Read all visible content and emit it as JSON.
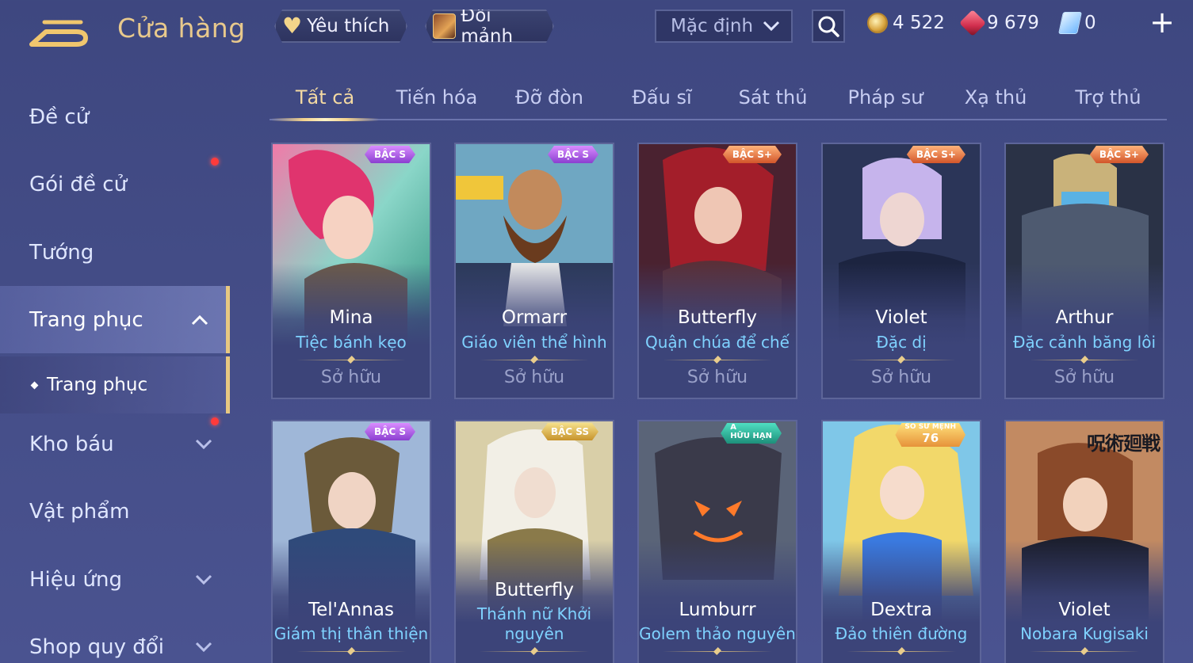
{
  "header": {
    "title": "Cửa hàng",
    "favorite_label": "Yêu thích",
    "exchange_label": "Đổi mảnh",
    "sort_value": "Mặc định",
    "currencies": {
      "gold": "4 522",
      "ruby": "9 679",
      "voucher": "0"
    },
    "colors": {
      "accent_gold": "#e8c98c",
      "skin_name_blue": "#7fd2ff"
    }
  },
  "sidebar": {
    "items": [
      {
        "label": "Đề cử"
      },
      {
        "label": "Gói đề cử"
      },
      {
        "label": "Tướng"
      },
      {
        "label": "Trang phục"
      },
      {
        "label": "Kho báu"
      },
      {
        "label": "Vật phẩm"
      },
      {
        "label": "Hiệu ứng"
      },
      {
        "label": "Shop quy đổi"
      }
    ],
    "sub_item": "Trang phục"
  },
  "tabs": [
    {
      "label": "Tất cả"
    },
    {
      "label": "Tiến hóa"
    },
    {
      "label": "Đỡ đòn"
    },
    {
      "label": "Đấu sĩ"
    },
    {
      "label": "Sát thủ"
    },
    {
      "label": "Pháp sư"
    },
    {
      "label": "Xạ thủ"
    },
    {
      "label": "Trợ thủ"
    }
  ],
  "cards": [
    {
      "hero": "Mina",
      "skin": "Tiệc bánh kẹo",
      "status": "Sở hữu",
      "badge": "BẬC S"
    },
    {
      "hero": "Ormarr",
      "skin": "Giáo viên thể hình",
      "status": "Sở hữu",
      "badge": "BẬC S"
    },
    {
      "hero": "Butterfly",
      "skin": "Quận chúa để chế",
      "status": "Sở hữu",
      "badge": "BẬC S+"
    },
    {
      "hero": "Violet",
      "skin": "Đặc dị",
      "status": "Sở hữu",
      "badge": "BẬC S+"
    },
    {
      "hero": "Arthur",
      "skin": "Đặc cảnh băng lôi",
      "status": "Sở hữu",
      "badge": "BẬC S+"
    },
    {
      "hero": "Tel'Annas",
      "skin": "Giám thị thân thiện",
      "badge": "BẬC S"
    },
    {
      "hero": "Butterfly",
      "skin": "Thánh nữ Khởi nguyên",
      "badge": "BẬC SS"
    },
    {
      "hero": "Lumburr",
      "skin": "Golem thảo nguyên",
      "badge": "A",
      "badge_sub": "HỮU HẠN"
    },
    {
      "hero": "Dextra",
      "skin": "Đảo thiên đường",
      "badge": "SỐ SỨ MỆNH",
      "badge_num": "76"
    },
    {
      "hero": "Violet",
      "skin": "Nobara Kugisaki",
      "corner_text": "呪術廻戦"
    }
  ]
}
